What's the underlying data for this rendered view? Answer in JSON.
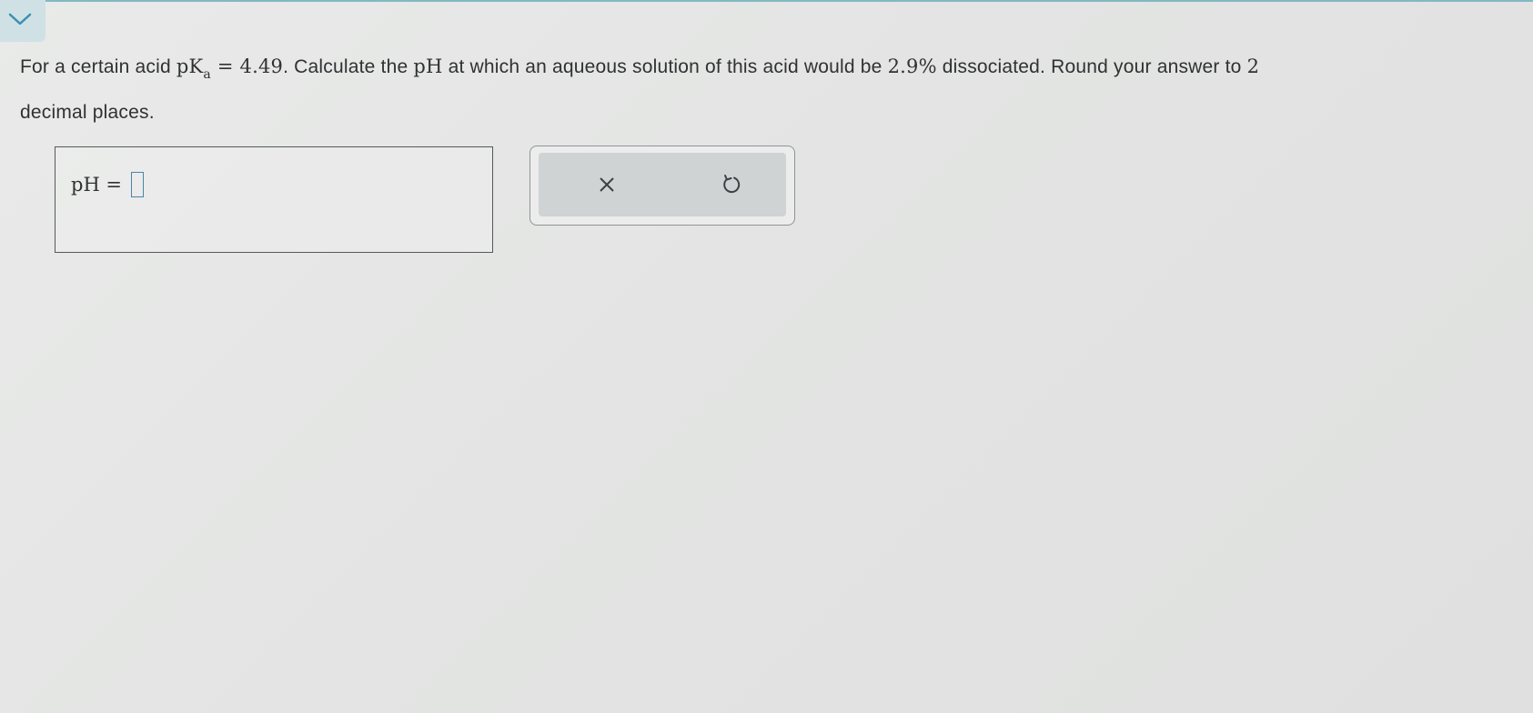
{
  "question": {
    "text_before": "For a certain acid ",
    "pka_symbol": "pK",
    "pka_subscript": "a",
    "text_after_pka": " = 4.49",
    "text_mid": ". Calculate the ",
    "ph_symbol": "pH",
    "text_after_ph": " at which an aqueous solution of this acid would be ",
    "percent": "2.9%",
    "text_end": " dissociated. Round your answer to ",
    "decimals": "2",
    "text_tail": " decimal places."
  },
  "answer": {
    "label": "pH =",
    "value": ""
  },
  "icons": {
    "collapse": "chevron-down-icon",
    "clear": "close-icon",
    "undo": "undo-icon"
  },
  "colors": {
    "accent": "#4a86a8",
    "tab_background": "#cfe1e5"
  }
}
